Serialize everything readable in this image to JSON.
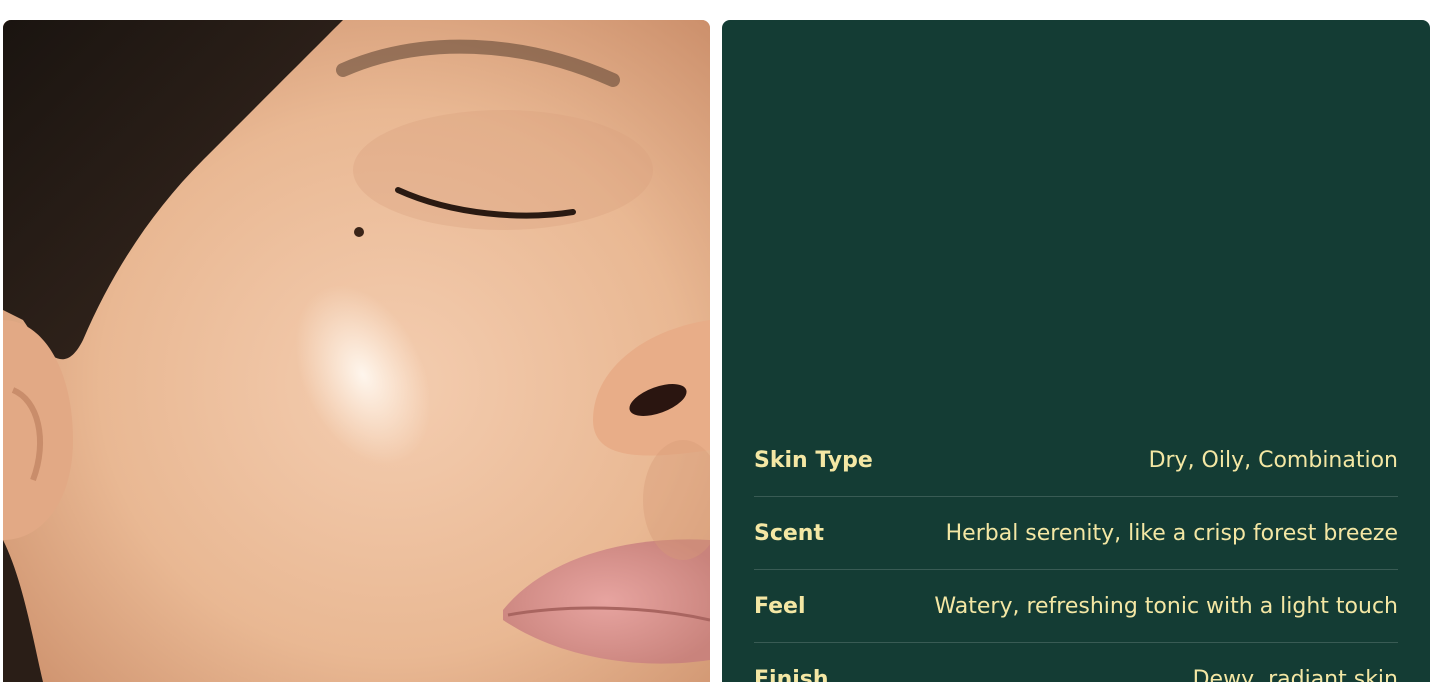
{
  "product_image": {
    "icon": "model-face-photo"
  },
  "attributes": [
    {
      "label": "Skin Type",
      "value": "Dry, Oily, Combination"
    },
    {
      "label": "Scent",
      "value": "Herbal serenity, like a crisp forest breeze"
    },
    {
      "label": "Feel",
      "value": "Watery, refreshing tonic with a light touch"
    },
    {
      "label": "Finish",
      "value": "Dewy, radiant skin"
    }
  ],
  "colors": {
    "panel_bg": "#143c34",
    "text_accent": "#f4e7a4",
    "divider": "rgba(255,255,255,0.16)"
  }
}
